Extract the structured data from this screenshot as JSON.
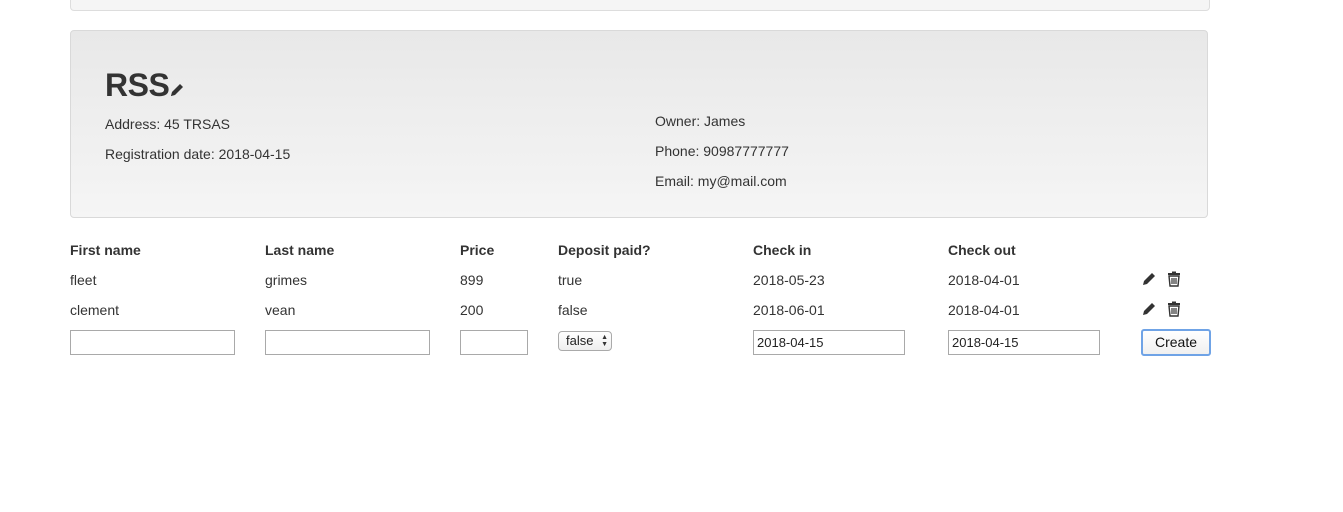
{
  "hotel": {
    "name": "RSS",
    "address": "Address: 45 TRSAS",
    "registration": "Registration date: 2018-04-15",
    "owner": "Owner: James",
    "phone": "Phone: 90987777777",
    "email": "Email: my@mail.com"
  },
  "table": {
    "headers": [
      "First name",
      "Last name",
      "Price",
      "Deposit paid?",
      "Check in",
      "Check out"
    ],
    "rows": [
      {
        "first": "fleet",
        "last": "grimes",
        "price": "899",
        "deposit": "true",
        "checkin": "2018-05-23",
        "checkout": "2018-04-01"
      },
      {
        "first": "clement",
        "last": "vean",
        "price": "200",
        "deposit": "false",
        "checkin": "2018-06-01",
        "checkout": "2018-04-01"
      }
    ]
  },
  "form": {
    "first_value": "",
    "last_value": "",
    "price_value": "",
    "deposit_selected": "false",
    "checkin_value": "2018-04-15",
    "checkout_value": "2018-04-15",
    "create_label": "Create"
  },
  "icons": {
    "edit": "pencil-icon",
    "delete": "trash-icon"
  }
}
